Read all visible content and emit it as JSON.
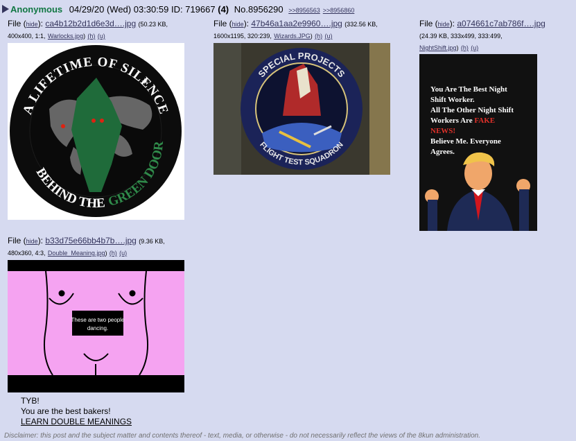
{
  "post": {
    "name": "Anonymous",
    "date": "04/29/20 (Wed) 03:30:59",
    "id_label": "ID:",
    "id_value": "719667",
    "id_count": "(4)",
    "post_no": "No.8956290",
    "backlinks": [
      ">>8956563",
      ">>8956860"
    ]
  },
  "files": [
    {
      "prefix": "File (",
      "hide": "hide",
      "sep": "):",
      "filename": "ca4b12b2d1d6e3d….jpg",
      "meta1": "(50.23 KB,",
      "meta2": "400x400, 1:1,",
      "orig": "Warlocks.jpg",
      "h": "(h)",
      "u": "(u)",
      "image_text": {
        "top": "A LIFETIME OF SILENCE",
        "bottom_a": "BEHIND THE",
        "bottom_b": "GREEN DOOR"
      }
    },
    {
      "prefix": "File (",
      "hide": "hide",
      "sep": "):",
      "filename": "47b46a1aa2e9960….jpg",
      "meta1": "(332.56 KB,",
      "meta2": "1600x1195, 320:239,",
      "orig": "Wizards.JPG",
      "h": "(h)",
      "u": "(u)",
      "image_text": {
        "top": "SPECIAL PROJECTS",
        "bottom": "FLIGHT TEST SQUADRON"
      }
    },
    {
      "prefix": "File (",
      "hide": "hide",
      "sep": "):",
      "filename": "a074661c7ab786f….jpg",
      "meta1": "(24.39 KB, 333x499, 333:499,",
      "orig": "NightShift.jpg",
      "h": "(h)",
      "u": "(u)",
      "image_text": {
        "line1": "You Are The Best Night",
        "line2": "Shift Worker.",
        "line3": "All The Other Night Shift",
        "line4": "Workers Are ",
        "line4_red": "FAKE",
        "line5_red": "NEWS!",
        "line6": "Believe Me. Everyone",
        "line7": "Agrees."
      }
    },
    {
      "prefix": "File (",
      "hide": "hide",
      "sep": "):",
      "filename": "b33d75e66bb4b7b….jpg",
      "meta1": "(9.36 KB,",
      "meta2": "480x360, 4:3,",
      "orig": "Double_Meaning.jpg",
      "h": "(h)",
      "u": "(u)",
      "image_text": {
        "caption1": "These are two people",
        "caption2": "dancing."
      }
    }
  ],
  "body": {
    "line1": "TYB!",
    "line2": "You are the best bakers!",
    "line3": "LEARN DOUBLE MEANINGS"
  },
  "disclaimer": "Disclaimer: this post and the subject matter and contents thereof - text, media, or otherwise - do not necessarily reflect the views of the 8kun administration.",
  "colors": {
    "background": "#d6daf0",
    "name": "#117743",
    "link": "#34345c",
    "fake_news": "#e0312a"
  }
}
